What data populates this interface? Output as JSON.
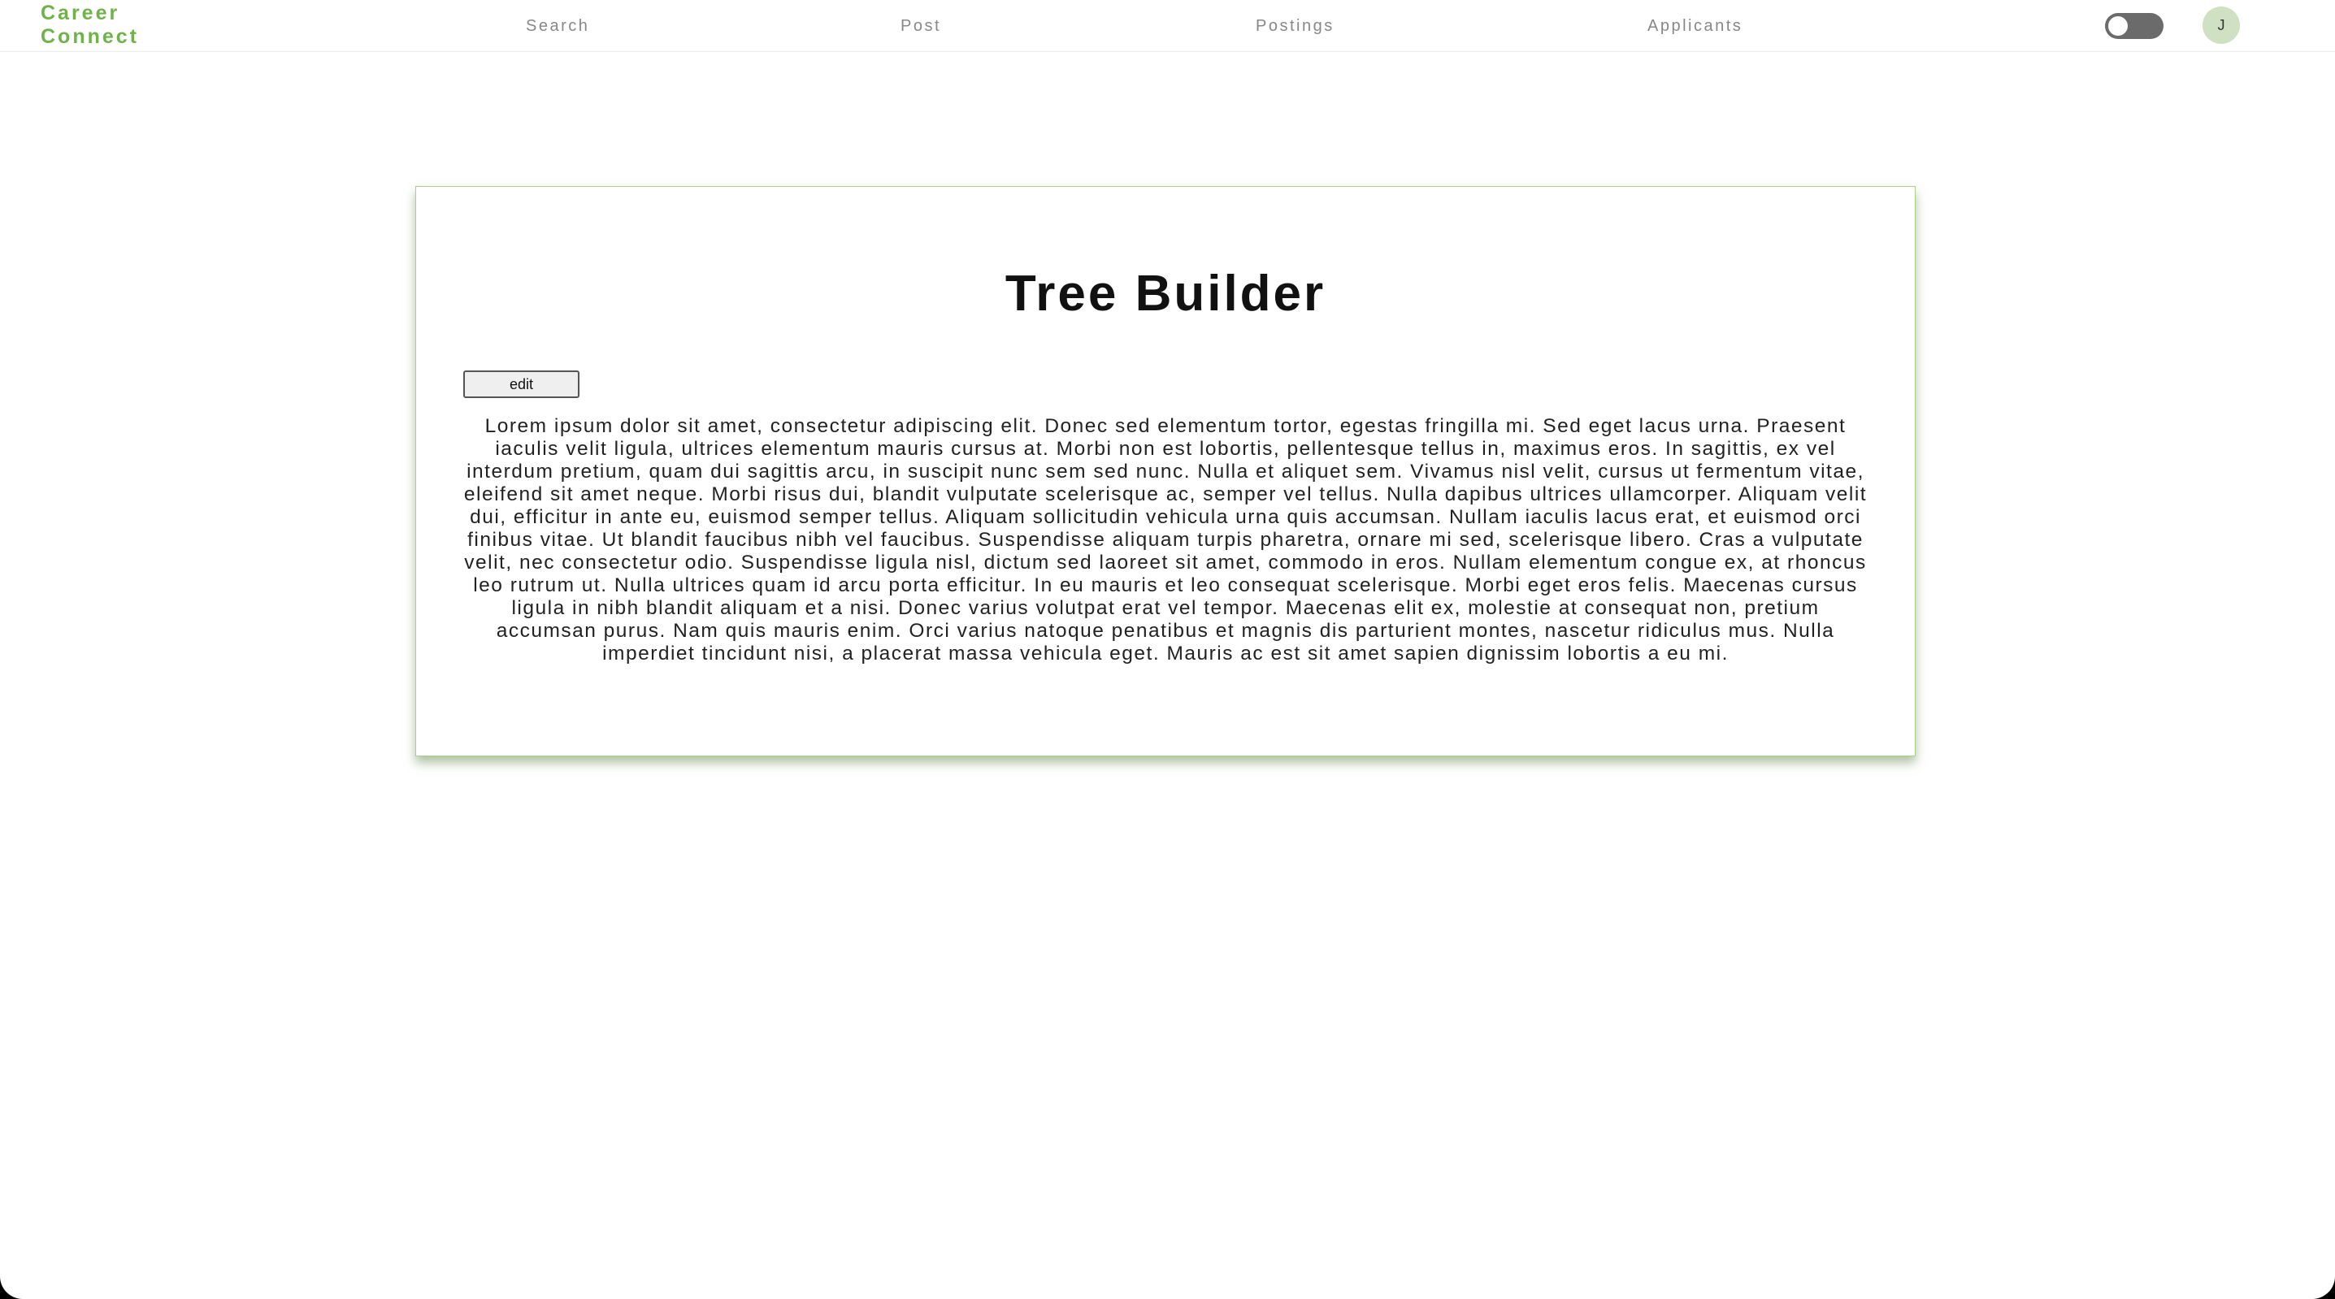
{
  "brand": {
    "line1": "Career",
    "line2": "Connect",
    "color": "#6fb24a"
  },
  "nav": {
    "search": "Search",
    "post": "Post",
    "postings": "Postings",
    "applicants": "Applicants"
  },
  "header_controls": {
    "theme_toggle": {
      "state": "off",
      "icon": "toggle-switch"
    },
    "avatar_initial": "J"
  },
  "card": {
    "title": "Tree Builder",
    "edit_label": "edit",
    "body": "Lorem ipsum dolor sit amet, consectetur adipiscing elit. Donec sed elementum tortor, egestas fringilla mi. Sed eget lacus urna. Praesent iaculis velit ligula, ultrices elementum mauris cursus at. Morbi non est lobortis, pellentesque tellus in, maximus eros. In sagittis, ex vel interdum pretium, quam dui sagittis arcu, in suscipit nunc sem sed nunc. Nulla et aliquet sem. Vivamus nisl velit, cursus ut fermentum vitae, eleifend sit amet neque. Morbi risus dui, blandit vulputate scelerisque ac, semper vel tellus. Nulla dapibus ultrices ullamcorper. Aliquam velit dui, efficitur in ante eu, euismod semper tellus. Aliquam sollicitudin vehicula urna quis accumsan. Nullam iaculis lacus erat, et euismod orci finibus vitae. Ut blandit faucibus nibh vel faucibus. Suspendisse aliquam turpis pharetra, ornare mi sed, scelerisque libero. Cras a vulputate velit, nec consectetur odio. Suspendisse ligula nisl, dictum sed laoreet sit amet, commodo in eros. Nullam elementum congue ex, at rhoncus leo rutrum ut. Nulla ultrices quam id arcu porta efficitur. In eu mauris et leo consequat scelerisque. Morbi eget eros felis. Maecenas cursus ligula in nibh blandit aliquam et a nisi. Donec varius volutpat erat vel tempor. Maecenas elit ex, molestie at consequat non, pretium accumsan purus. Nam quis mauris enim. Orci varius natoque penatibus et magnis dis parturient montes, nascetur ridiculus mus. Nulla imperdiet tincidunt nisi, a placerat massa vehicula eget. Mauris ac est sit amet sapien dignissim lobortis a eu mi.",
    "border_color": "#a9d08c"
  }
}
